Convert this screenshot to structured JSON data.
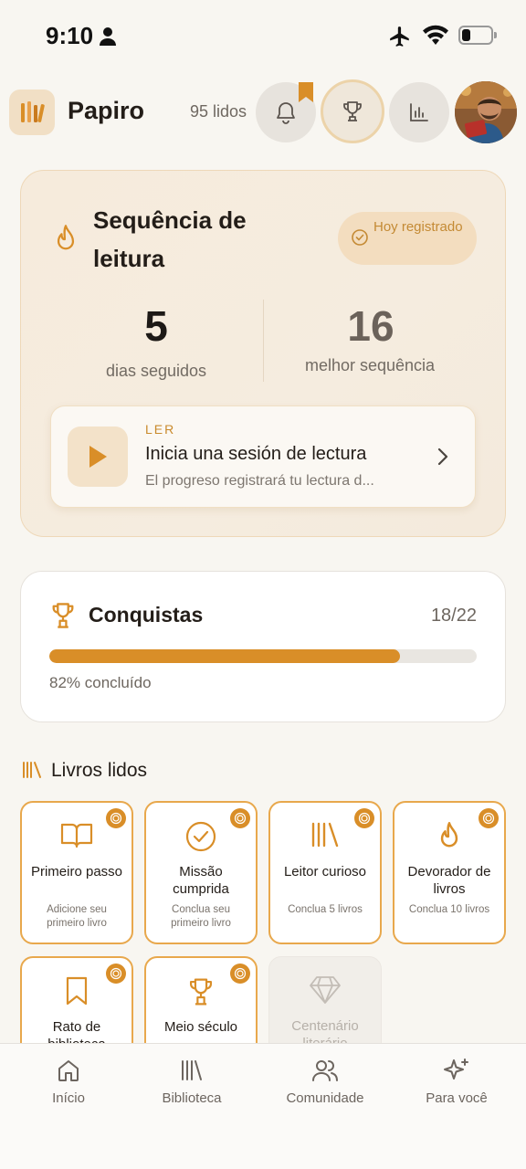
{
  "status": {
    "time": "9:10"
  },
  "header": {
    "app_name": "Papiro",
    "read_count": "95 lidos"
  },
  "streak": {
    "title": "Sequência de leitura",
    "today_badge": "Hoy registrado",
    "current_value": "5",
    "current_label": "dias seguidos",
    "best_value": "16",
    "best_label": "melhor sequência",
    "session": {
      "kicker": "LER",
      "title": "Inicia una sesión de lectura",
      "subtitle": "El progreso registrará tu lectura d..."
    }
  },
  "achievements": {
    "title": "Conquistas",
    "count": "18/22",
    "progress": 0.82,
    "progress_label": "82% concluído"
  },
  "books_read": {
    "section_title": "Livros lidos",
    "badges": [
      {
        "name": "Primeiro passo",
        "desc": "Adicione seu primeiro livro",
        "icon": "book-open-icon",
        "unlocked": true
      },
      {
        "name": "Missão cumprida",
        "desc": "Conclua seu primeiro livro",
        "icon": "check-circle-icon",
        "unlocked": true
      },
      {
        "name": "Leitor curioso",
        "desc": "Conclua 5 livros",
        "icon": "library-icon",
        "unlocked": true
      },
      {
        "name": "Devorador de livros",
        "desc": "Conclua 10 livros",
        "icon": "flame-icon",
        "unlocked": true
      },
      {
        "name": "Rato de biblioteca",
        "desc": "",
        "icon": "bookmark-icon",
        "unlocked": true
      },
      {
        "name": "Meio século",
        "desc": "",
        "icon": "trophy-icon",
        "unlocked": true
      },
      {
        "name": "Centenário literário",
        "desc": "",
        "icon": "gem-icon",
        "unlocked": false
      }
    ]
  },
  "nav": {
    "items": [
      {
        "label": "Início",
        "icon": "home-icon"
      },
      {
        "label": "Biblioteca",
        "icon": "library-icon"
      },
      {
        "label": "Comunidade",
        "icon": "users-icon"
      },
      {
        "label": "Para você",
        "icon": "sparkles-icon"
      }
    ]
  },
  "colors": {
    "accent": "#d98e28",
    "background": "#f8f6f1",
    "card_warm": "#f6ebdc"
  }
}
